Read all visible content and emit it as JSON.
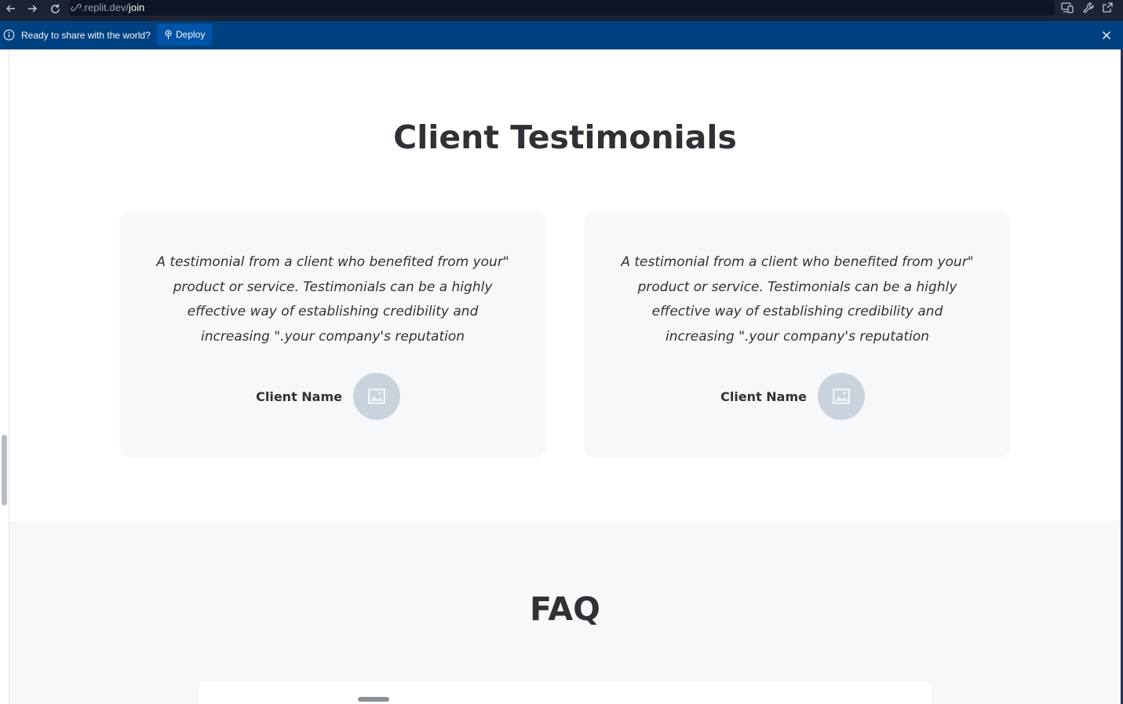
{
  "browser": {
    "url_prefix": ".replit.dev/",
    "url_path": "join",
    "back_icon": "arrow-left-icon",
    "forward_icon": "arrow-right-icon",
    "reload_icon": "reload-icon",
    "right_icons": [
      "devices-icon",
      "wrench-icon",
      "external-link-icon"
    ]
  },
  "banner": {
    "message": "Ready to share with the world?",
    "deploy_label": "Deploy",
    "background": "#004182",
    "button_color": "#0053a6"
  },
  "testimonials": {
    "title": "Client Testimonials",
    "cards": [
      {
        "quote": "A testimonial from a client who benefited from your\" product or service. Testimonials can be a highly effective way of establishing credibility and increasing \".your company's reputation",
        "name": "Client Name",
        "avatar_icon": "image-placeholder-icon"
      },
      {
        "quote": "A testimonial from a client who benefited from your\" product or service. Testimonials can be a highly effective way of establishing credibility and increasing \".your company's reputation",
        "name": "Client Name",
        "avatar_icon": "image-placeholder-icon"
      }
    ]
  },
  "faq": {
    "title": "FAQ"
  }
}
